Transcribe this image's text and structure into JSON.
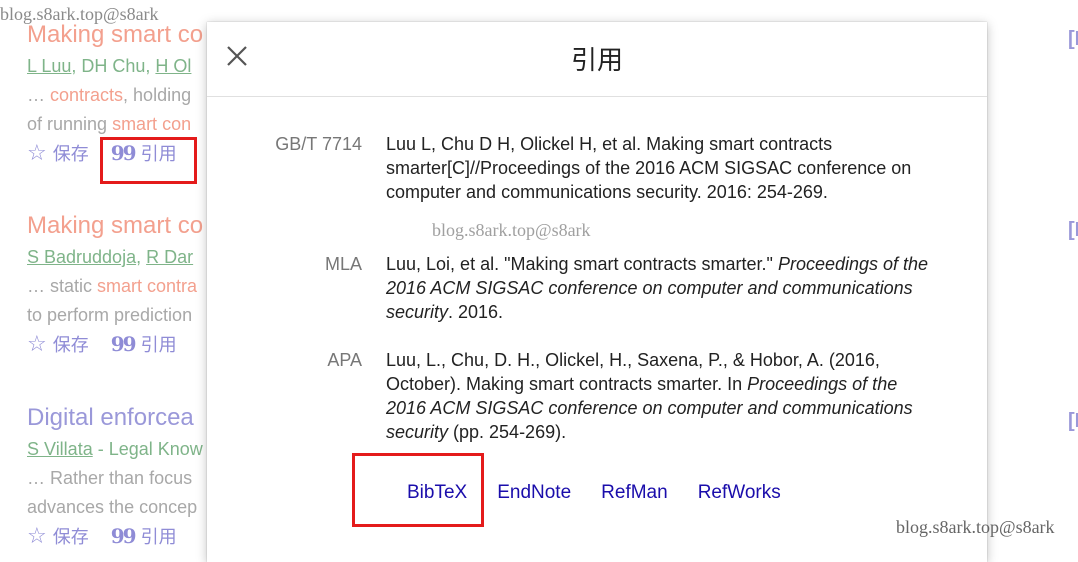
{
  "watermark": "blog.s8ark.top@s8ark",
  "results": [
    {
      "title": "Making smart co",
      "authors_a": "L Luu",
      "authors_b": ", DH Chu, ",
      "authors_c": "H Ol",
      "snip1_a": "… ",
      "snip1_hl": "contracts",
      "snip1_b": ", holding",
      "snip2_a": "of running ",
      "snip2_hl": "smart con",
      "save": "保存",
      "cite": "引用"
    },
    {
      "title": "Making smart co",
      "authors_a": "S Badruddoja",
      "authors_b": ", ",
      "authors_c": "R Dar",
      "snip1_a": "… static ",
      "snip1_hl": "smart contra",
      "snip1_b": "",
      "snip2_a": "to perform prediction",
      "snip2_hl": "",
      "save": "保存",
      "cite": "引用"
    },
    {
      "title": "Digital enforcea",
      "authors_a": "S Villata",
      "authors_b": " - Legal Know",
      "authors_c": "",
      "snip1_a": "… Rather than focus",
      "snip1_hl": "",
      "snip1_b": "",
      "snip2_a": "advances the concep",
      "snip2_hl": "",
      "save": "保存",
      "cite": "引用"
    }
  ],
  "side_tags": [
    "[I",
    "[I",
    "[I"
  ],
  "dialog": {
    "title": "引用",
    "close_icon": "close-icon",
    "citations": [
      {
        "label": "GB/T 7714",
        "text": "Luu L, Chu D H, Olickel H, et al. Making smart contracts smarter[C]//Proceedings of the 2016 ACM SIGSAC conference on computer and communications security. 2016: 254-269."
      },
      {
        "label": "MLA",
        "text_a": "Luu, Loi, et al. \"Making smart contracts smarter.\" ",
        "text_i": "Proceedings of the 2016 ACM SIGSAC conference on computer and communications security",
        "text_b": ". 2016."
      },
      {
        "label": "APA",
        "text_a": "Luu, L., Chu, D. H., Olickel, H., Saxena, P., & Hobor, A. (2016, October). Making smart contracts smarter. In ",
        "text_i": "Proceedings of the 2016 ACM SIGSAC conference on computer and communications security",
        "text_b": " (pp. 254-269)."
      }
    ],
    "export_links": [
      "BibTeX",
      "EndNote",
      "RefMan",
      "RefWorks"
    ]
  },
  "colors": {
    "highlight_box": "#e41b1b",
    "link": "#1a0dab",
    "dim_title": "#f3a08e",
    "dim_title_visited": "#9a98d9",
    "dim_author": "#7fb489"
  }
}
